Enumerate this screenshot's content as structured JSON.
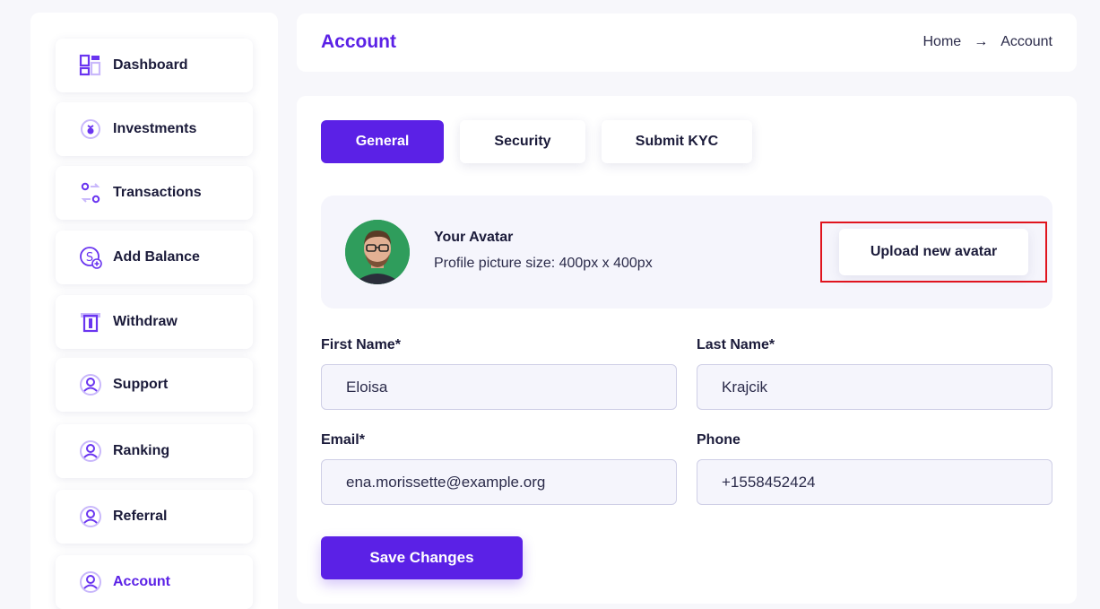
{
  "sidebar": {
    "items": [
      {
        "label": "Dashboard",
        "icon": "dashboard-icon"
      },
      {
        "label": "Investments",
        "icon": "investments-icon"
      },
      {
        "label": "Transactions",
        "icon": "transactions-icon"
      },
      {
        "label": "Add Balance",
        "icon": "add-balance-icon"
      },
      {
        "label": "Withdraw",
        "icon": "withdraw-icon"
      },
      {
        "label": "Support",
        "icon": "user-icon"
      },
      {
        "label": "Ranking",
        "icon": "user-icon"
      },
      {
        "label": "Referral",
        "icon": "user-icon"
      },
      {
        "label": "Account",
        "icon": "user-icon",
        "active": true
      }
    ]
  },
  "header": {
    "title": "Account",
    "breadcrumb": {
      "home": "Home",
      "arrow": "→",
      "current": "Account"
    }
  },
  "tabs": [
    {
      "label": "General",
      "active": true
    },
    {
      "label": "Security"
    },
    {
      "label": "Submit KYC"
    }
  ],
  "avatar": {
    "title": "Your Avatar",
    "subtitle": "Profile picture size: 400px x 400px",
    "upload_label": "Upload new avatar"
  },
  "form": {
    "first_name_label": "First Name*",
    "first_name_value": "Eloisa",
    "last_name_label": "Last Name*",
    "last_name_value": "Krajcik",
    "email_label": "Email*",
    "email_value": "ena.morissette@example.org",
    "phone_label": "Phone",
    "phone_value": "+1558452424",
    "save_label": "Save Changes"
  },
  "colors": {
    "accent": "#5b21e6",
    "highlight": "#e0141e",
    "background": "#f7f7fb"
  }
}
